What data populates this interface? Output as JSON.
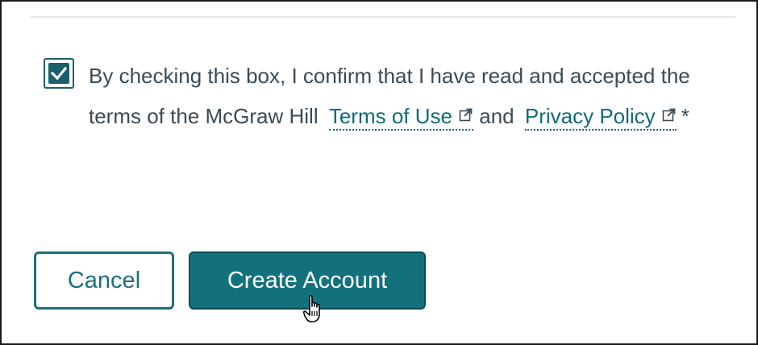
{
  "consent": {
    "checked": true,
    "text_before": "By checking this box, I confirm that I have read and accepted the terms of the McGraw Hill",
    "terms_link": "Terms of Use",
    "connector": "and",
    "privacy_link": "Privacy Policy",
    "required_marker": "*",
    "external_icon": "external-link-icon"
  },
  "buttons": {
    "cancel_label": "Cancel",
    "create_label": "Create Account"
  },
  "colors": {
    "accent": "#13717e",
    "accent_dark": "#0c4c57",
    "link": "#0d6a7a",
    "text": "#3a4b57"
  }
}
